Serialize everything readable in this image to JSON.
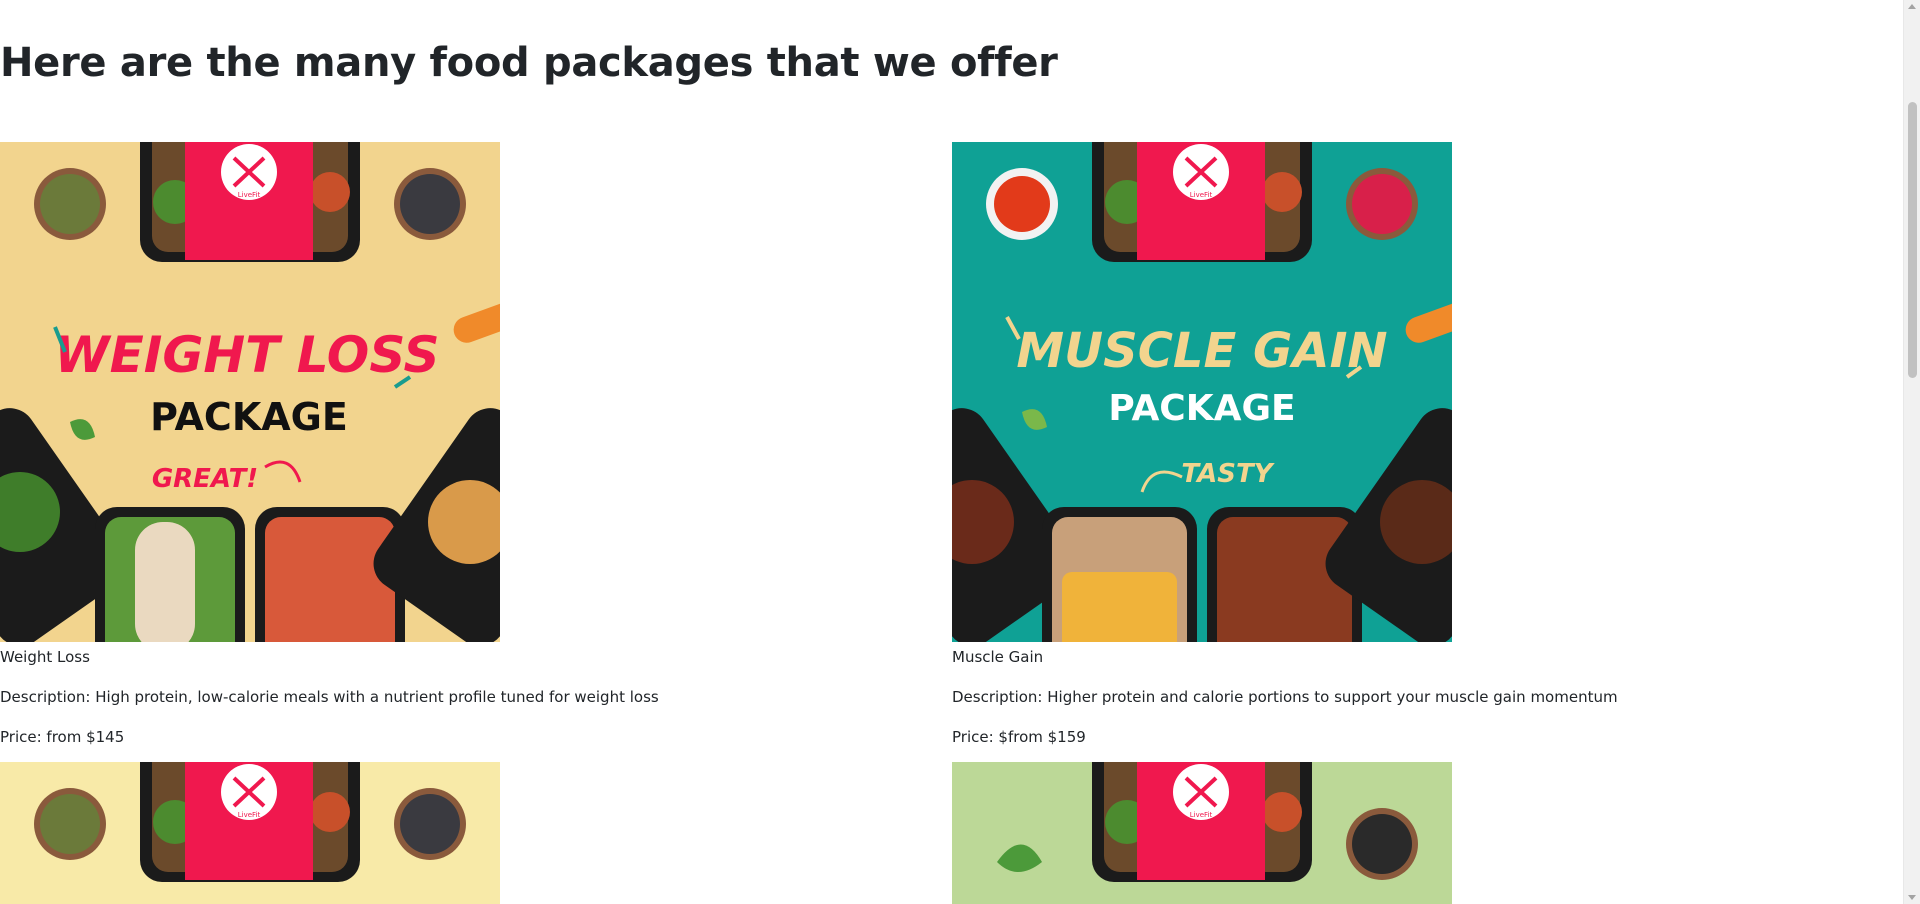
{
  "page": {
    "heading": "Here are the many food packages that we offer"
  },
  "packages": [
    {
      "title": "Weight Loss",
      "description": "Description: High protein, low-calorie meals with a nutrient profile tuned for weight loss",
      "price": "Price: from $145",
      "image": {
        "headline": "WEIGHT LOSS",
        "subline": "PACKAGE",
        "tag": "GREAT!",
        "brand": "LiveFit",
        "background": "#f2d48e",
        "headline_color": "#f0184e",
        "subline_color": "#111111",
        "tag_color": "#f0184e"
      }
    },
    {
      "title": "Muscle Gain",
      "description": "Description: Higher protein and calorie portions to support your muscle gain momentum",
      "price": "Price: $from $159",
      "image": {
        "headline": "MUSCLE GAIN",
        "subline": "PACKAGE",
        "tag": "TASTY",
        "brand": "LiveFit",
        "background": "#0fa195",
        "headline_color": "#f2d48e",
        "subline_color": "#ffffff",
        "tag_color": "#f2d48e"
      }
    },
    {
      "image": {
        "brand": "LiveFit",
        "background": "#f8eaa8"
      }
    },
    {
      "image": {
        "brand": "LiveFit",
        "background": "#bcd897"
      }
    }
  ],
  "colors": {
    "brand_band": "#f0184e",
    "text": "#212529"
  }
}
